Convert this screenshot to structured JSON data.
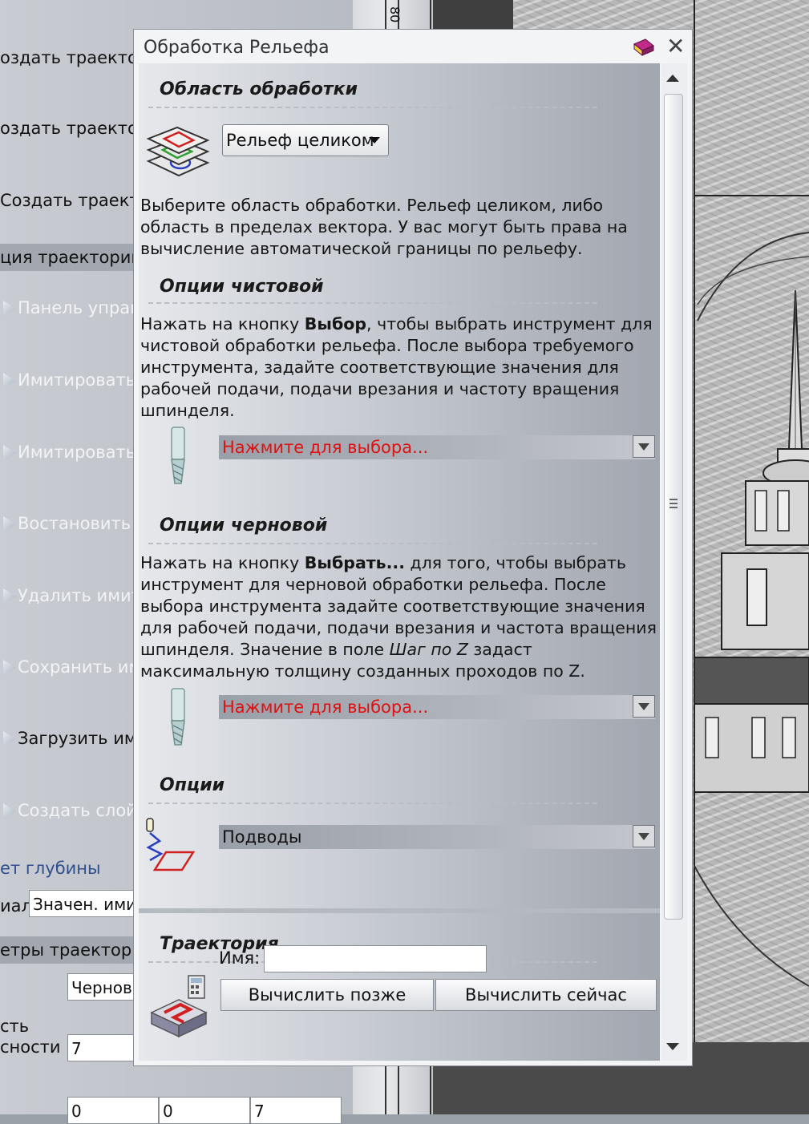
{
  "left_panel": {
    "items": [
      {
        "label": "оздать траекто",
        "dim": false
      },
      {
        "label": "оздать траекто",
        "dim": false
      },
      {
        "label": "Создать траекто",
        "dim": false
      }
    ],
    "header1": "ция траектории",
    "dim_items": [
      "Панель управл",
      "Имитировать т",
      "Имитировать в",
      "Востановить и",
      "Удалить имит",
      "Сохранить им"
    ],
    "load_item": "Загрузить ими",
    "layer_item": "Создать слой",
    "depth_link": "ет глубины",
    "material_label": "иал",
    "material_value": "Значен. имит",
    "header2": "етры траектори",
    "name_value": "Чернова",
    "accuracy_label_1": "сть",
    "accuracy_label_2": "сности",
    "accuracy_value": "7",
    "coords": [
      "0",
      "0",
      "7"
    ]
  },
  "ruler": {
    "label": "80"
  },
  "dialog": {
    "title": "Обработка Рельефа",
    "area": {
      "title": "Область обработки",
      "combo_value": "Рельеф целиком",
      "description": "Выберите область обработки. Рельеф целиком, либо область в пределах вектора. У вас могут быть права на вычисление автоматической границы по рельефу."
    },
    "finish": {
      "title": "Опции чистовой",
      "text_before": "Нажать на кнопку ",
      "bold": "Выбор",
      "text_after": ", чтобы выбрать инструмент для чистовой обработки рельефа. После выбора требуемого инструмента, задайте соответствующие значения для рабочей подачи, подачи врезания и частоту вращения шпинделя.",
      "tool_prompt": "Нажмите для выбора..."
    },
    "rough": {
      "title": "Опции черновой",
      "text_before": "Нажать на кнопку ",
      "bold": "Выбрать...",
      "text_mid": " для того, чтобы выбрать инструмент для черновой обработки рельефа. После выбора инструмента задайте соответствующие значения для рабочей подачи, подачи врезания и частота вращения шпинделя. Значение в поле ",
      "italic": "Шаг по Z",
      "text_after": " задаст максимальную толщину созданных проходов по Z.",
      "tool_prompt": "Нажмите для выбора..."
    },
    "options": {
      "title": "Опции",
      "leadin_value": "Подводы"
    },
    "toolpath": {
      "title": "Траектория",
      "name_label": "Имя:",
      "name_value": "",
      "calc_later": "Вычислить позже",
      "calc_now": "Вычислить сейчас"
    }
  },
  "colors": {
    "prompt_red": "#e01010",
    "link_blue": "#2f4f8f"
  },
  "icons": [
    "area-layers-icon",
    "endmill-tool-icon",
    "leadin-ramp-icon",
    "toolpath-calc-icon",
    "book-icon",
    "close-icon"
  ]
}
